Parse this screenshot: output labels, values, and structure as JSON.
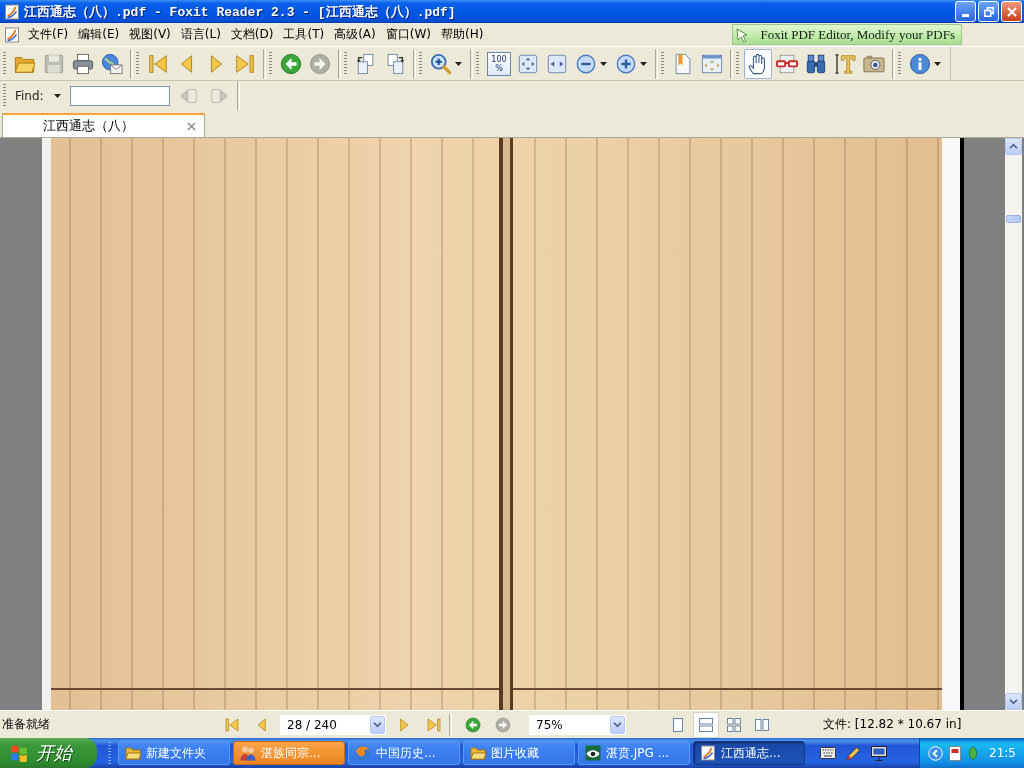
{
  "window": {
    "title": "江西通志（八）.pdf - Foxit Reader 2.3 - [江西通志（八）.pdf]"
  },
  "menu_bar": {
    "items": [
      "文件(F)",
      "编辑(E)",
      "视图(V)",
      "语言(L)",
      "文档(D)",
      "工具(T)",
      "高级(A)",
      "窗口(W)",
      "帮助(H)"
    ],
    "promo": "Foxit PDF Editor, Modify your PDFs"
  },
  "toolbar": {
    "groups": [
      [
        {
          "kind": "open",
          "selected": false,
          "disabled": false
        },
        {
          "kind": "save",
          "selected": false,
          "disabled": true
        },
        {
          "kind": "print",
          "selected": false,
          "disabled": false
        },
        {
          "kind": "email",
          "selected": false,
          "disabled": false
        }
      ],
      [
        {
          "kind": "first-page",
          "selected": false,
          "disabled": false
        },
        {
          "kind": "previous-page",
          "selected": false,
          "disabled": false
        },
        {
          "kind": "next-page",
          "selected": false,
          "disabled": false
        },
        {
          "kind": "last-page",
          "selected": false,
          "disabled": false
        }
      ],
      [
        {
          "kind": "back",
          "selected": false,
          "disabled": false
        },
        {
          "kind": "forward",
          "selected": false,
          "disabled": true
        }
      ],
      [
        {
          "kind": "rotate-left",
          "selected": false,
          "disabled": false
        },
        {
          "kind": "rotate-right",
          "selected": false,
          "disabled": false
        }
      ],
      [
        {
          "kind": "zoom-tool",
          "selected": false,
          "disabled": false,
          "dropdown": true
        }
      ],
      [
        {
          "kind": "actual-size",
          "label": "100 %",
          "selected": false,
          "disabled": false
        },
        {
          "kind": "fit-page",
          "selected": false,
          "disabled": false
        },
        {
          "kind": "fit-width",
          "selected": false,
          "disabled": false
        },
        {
          "kind": "zoom-out",
          "selected": false,
          "disabled": false,
          "dropdown": true
        },
        {
          "kind": "zoom-in",
          "selected": false,
          "disabled": false,
          "dropdown": true
        }
      ],
      [
        {
          "kind": "bookmarks",
          "selected": false,
          "disabled": false
        },
        {
          "kind": "full-screen",
          "selected": false,
          "disabled": false
        }
      ],
      [
        {
          "kind": "hand",
          "selected": true,
          "disabled": false
        },
        {
          "kind": "glasses",
          "selected": false,
          "disabled": false
        },
        {
          "kind": "find",
          "selected": false,
          "disabled": false
        },
        {
          "kind": "select-text",
          "selected": false,
          "disabled": false
        },
        {
          "kind": "snapshot",
          "selected": false,
          "disabled": false
        }
      ],
      [
        {
          "kind": "info",
          "selected": false,
          "disabled": false,
          "dropdown": true
        }
      ]
    ]
  },
  "find_bar": {
    "label": "Find:",
    "buttons": [
      {
        "kind": "find-previous",
        "disabled": true
      },
      {
        "kind": "find-next",
        "disabled": true
      }
    ]
  },
  "tabs": [
    {
      "label": "江西通志（八）",
      "selected": true
    }
  ],
  "status_bar": {
    "text": "准备就绪",
    "page_navigation": [
      {
        "kind": "first-page",
        "disabled": false
      },
      {
        "kind": "previous-page",
        "disabled": false
      }
    ],
    "page_field": "28 / 240",
    "page_navigation_end": [
      {
        "kind": "next-page",
        "disabled": false
      },
      {
        "kind": "last-page",
        "disabled": false
      }
    ],
    "history": [
      {
        "kind": "back",
        "disabled": false
      },
      {
        "kind": "forward",
        "disabled": true
      }
    ],
    "zoom_field": "75%",
    "view_modes": [
      {
        "kind": "single-page",
        "selected": false
      },
      {
        "kind": "continuous",
        "selected": true
      },
      {
        "kind": "continuous-facing",
        "selected": false
      },
      {
        "kind": "facing",
        "selected": false
      }
    ],
    "page_size": "文件: [12.82 * 10.67 in]"
  },
  "taskbar": {
    "start_button": "开始",
    "tasks": [
      {
        "kind": "folder",
        "label": "新建文件夹",
        "selected": false,
        "attention": false
      },
      {
        "kind": "people",
        "label": "湛族同宗...",
        "selected": false,
        "attention": true
      },
      {
        "kind": "browser",
        "label": "中国历史...",
        "selected": false,
        "attention": false
      },
      {
        "kind": "folder",
        "label": "图片收藏",
        "selected": false,
        "attention": false
      },
      {
        "kind": "image-viewer",
        "label": "湛贲.JPG ...",
        "selected": false,
        "attention": false
      },
      {
        "kind": "pdf",
        "label": "江西通志...",
        "selected": true,
        "attention": false
      }
    ],
    "clock": "21:5"
  }
}
